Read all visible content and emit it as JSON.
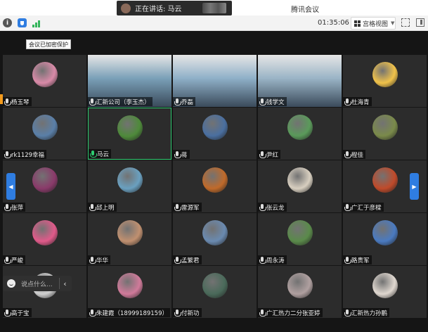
{
  "titlebar": {
    "speaking_label": "正在讲话: 马云",
    "app_title": "腾讯会议"
  },
  "toolbar": {
    "timer": "01:35:06",
    "layout_label": "宫格视图"
  },
  "meeting": {
    "encrypt_tip": "会议已加密保护",
    "chat_placeholder": "说点什么..."
  },
  "participants": [
    {
      "name": "杨玉琴",
      "type": "avatar",
      "color": "#d98aa8"
    },
    {
      "name": "汇新公司（李玉杰）",
      "type": "video",
      "color": "#7aa0b8"
    },
    {
      "name": "乔磊",
      "type": "video",
      "color": "#8fb0c8"
    },
    {
      "name": "钱学文",
      "type": "video",
      "color": "#9ab4c6"
    },
    {
      "name": "杜海青",
      "type": "avatar",
      "color": "#f0c24a"
    },
    {
      "name": "rk1129幸福",
      "type": "avatar",
      "color": "#5a7fa8"
    },
    {
      "name": "马云",
      "type": "avatar",
      "color": "#4e8a3a",
      "active": true
    },
    {
      "name": "蒋",
      "type": "avatar",
      "color": "#4a6fa0"
    },
    {
      "name": "尹红",
      "type": "avatar",
      "color": "#5a9a5a"
    },
    {
      "name": "程佳",
      "type": "avatar",
      "color": "#7a8a4a"
    },
    {
      "name": "张萍",
      "type": "avatar",
      "color": "#8a3a6a"
    },
    {
      "name": "邱上明",
      "type": "avatar",
      "color": "#6aa0c0"
    },
    {
      "name": "雷源军",
      "type": "avatar",
      "color": "#c06a2a"
    },
    {
      "name": "张云龙",
      "type": "avatar",
      "color": "#d8cfc0"
    },
    {
      "name": "广汇于彦樑",
      "type": "avatar",
      "color": "#c04a2a"
    },
    {
      "name": "严峻",
      "type": "avatar",
      "color": "#e05a8a"
    },
    {
      "name": "华华",
      "type": "avatar",
      "color": "#c09070"
    },
    {
      "name": "孟繁君",
      "type": "avatar",
      "color": "#6a8ab0"
    },
    {
      "name": "周永涛",
      "type": "avatar",
      "color": "#5a8a4a"
    },
    {
      "name": "路贵军",
      "type": "avatar",
      "color": "#4a7ac0"
    },
    {
      "name": "高于宝",
      "type": "avatar",
      "color": "#d0d0d0"
    },
    {
      "name": "朱建霞（18999189159）",
      "type": "avatar",
      "color": "#d07a9a"
    },
    {
      "name": "付新功",
      "type": "avatar",
      "color": "#4a6a5a"
    },
    {
      "name": "广汇热力二分张亚婷",
      "type": "avatar",
      "color": "#b0a0a0"
    },
    {
      "name": "汇新热力孙鹏",
      "type": "avatar",
      "color": "#e0d8d0"
    }
  ]
}
